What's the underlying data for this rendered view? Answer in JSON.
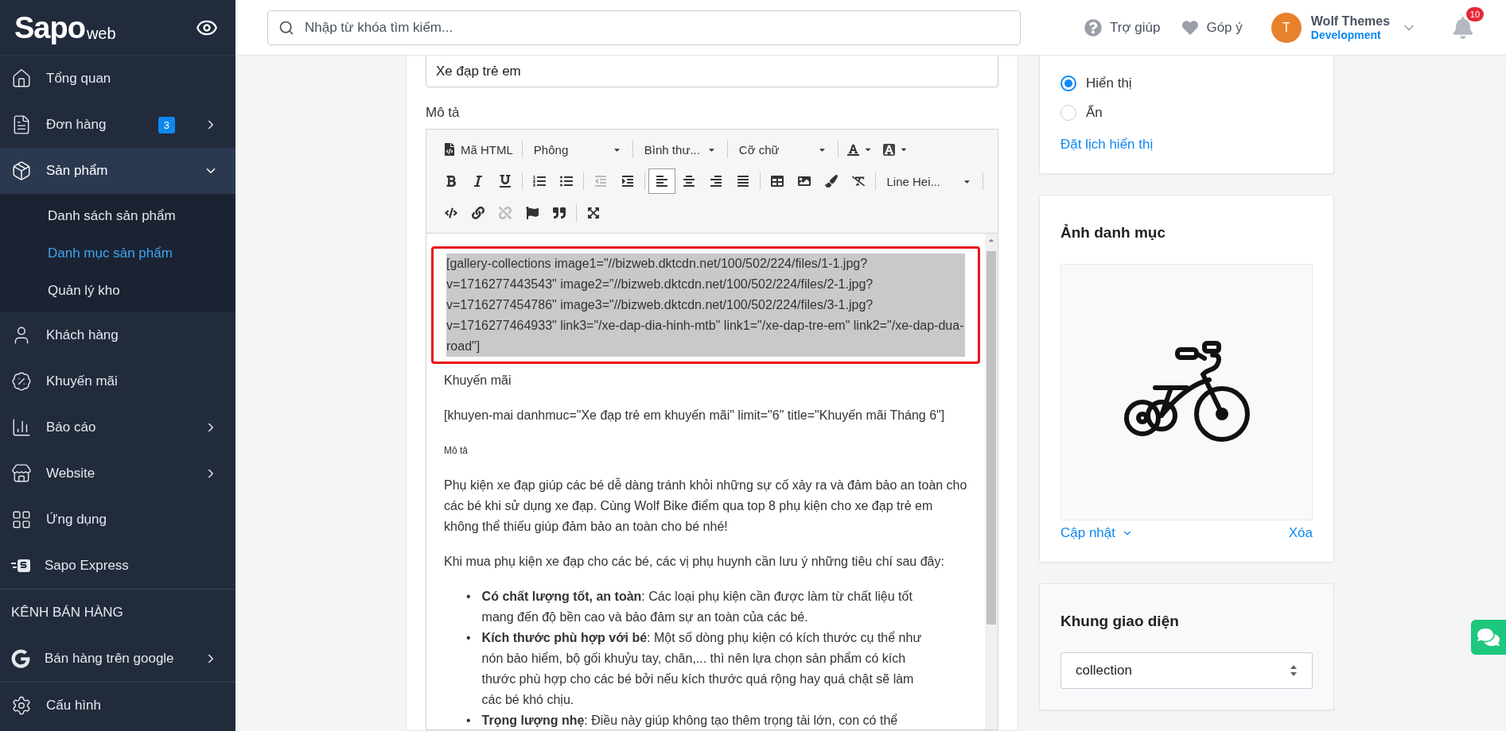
{
  "sidebar": {
    "logo": {
      "brand": "Sapo",
      "suffix": "web"
    },
    "items": [
      {
        "label": "Tổng quan",
        "kind": "home",
        "selected": false
      },
      {
        "label": "Đơn hàng",
        "kind": "orders",
        "selected": false,
        "badge": "3",
        "expanded": false
      },
      {
        "label": "Sản phẩm",
        "kind": "product",
        "selected": true,
        "expanded": true,
        "children": [
          {
            "label": "Danh sách sản phẩm",
            "selected": false
          },
          {
            "label": "Danh mục sản phẩm",
            "selected": true
          },
          {
            "label": "Quản lý kho",
            "selected": false
          }
        ]
      },
      {
        "label": "Khách hàng",
        "kind": "customer",
        "selected": false
      },
      {
        "label": "Khuyến mãi",
        "kind": "promo",
        "selected": false
      },
      {
        "label": "Báo cáo",
        "kind": "report",
        "selected": false,
        "expanded": false
      },
      {
        "label": "Website",
        "kind": "website",
        "selected": false,
        "expanded": false
      },
      {
        "label": "Ứng dụng",
        "kind": "apps",
        "selected": false
      },
      {
        "label": "Sapo Express",
        "kind": "express",
        "selected": false
      }
    ],
    "section_title": "KÊNH BÁN HÀNG",
    "channels": [
      {
        "label": "Bán hàng trên google",
        "kind": "google",
        "selected": false,
        "expanded": false
      }
    ],
    "footer": {
      "label": "Cấu hình",
      "kind": "settings",
      "selected": false
    }
  },
  "header": {
    "search": {
      "placeholder": "Nhập từ khóa tìm kiếm..."
    },
    "help": "Trợ giúp",
    "feedback": "Góp ý",
    "user": {
      "initial": "T",
      "name": "Wolf Themes",
      "store": "Development"
    },
    "notifications": "10"
  },
  "form": {
    "name_value": "Xe đạp trẻ em",
    "description_label": "Mô tả",
    "toolbar": [
      [
        {
          "kind": "html",
          "label": "Mã HTML"
        },
        {
          "kind": "dropdown",
          "label": "Phông"
        },
        {
          "kind": "dropdown",
          "label": "Bình thư..."
        },
        {
          "kind": "dropdown",
          "label": "Cỡ chữ"
        },
        {
          "kind": "fontcolor"
        },
        {
          "kind": "backcolor"
        }
      ],
      [
        {
          "kind": "bold"
        },
        {
          "kind": "italic"
        },
        {
          "kind": "underline"
        },
        {
          "kind": "olist"
        },
        {
          "kind": "ulist"
        },
        {
          "kind": "outdent",
          "disabled": true
        },
        {
          "kind": "indent"
        },
        {
          "kind": "alignleft",
          "selected": true
        },
        {
          "kind": "aligncenter",
          "selected": false
        },
        {
          "kind": "alignright",
          "selected": false
        },
        {
          "kind": "justify",
          "selected": false
        },
        {
          "kind": "table"
        },
        {
          "kind": "image"
        },
        {
          "kind": "brush"
        },
        {
          "kind": "clear"
        },
        {
          "kind": "dropdown",
          "label": "Line Hei..."
        }
      ],
      [
        {
          "kind": "code"
        },
        {
          "kind": "link"
        },
        {
          "kind": "unlink",
          "disabled": true
        },
        {
          "kind": "flag"
        },
        {
          "kind": "quote"
        },
        {
          "kind": "fullscreen"
        }
      ]
    ],
    "content": [
      {
        "kind": "highlight",
        "text": "[gallery-collections image1=\"//bizweb.dktcdn.net/100/502/224/files/1-1.jpg?v=1716277443543\" image2=\"//bizweb.dktcdn.net/100/502/224/files/2-1.jpg?v=1716277454786\" image3=\"//bizweb.dktcdn.net/100/502/224/files/3-1.jpg?v=1716277464933\" link3=\"/xe-dap-dia-hinh-mtb\" link1=\"/xe-dap-tre-em\" link2=\"/xe-dap-dua-road\"]"
      },
      {
        "kind": "paragraph",
        "text": "Khuyến mãi"
      },
      {
        "kind": "paragraph",
        "text": "[khuyen-mai danhmuc=\"Xe đạp trẻ em khuyến mãi\" limit=\"6\" title=\"Khuyến mãi Tháng 6\"]"
      },
      {
        "kind": "small",
        "text": "Mô tả"
      },
      {
        "kind": "paragraph",
        "text": "Phụ kiện xe đạp giúp các bé dễ dàng tránh khỏi những sự cố xảy ra và đảm bảo an toàn cho các bé khi sử dụng xe đạp. Cùng Wolf Bike điểm qua top 8 phụ kiện cho xe đạp trẻ em không thể thiếu giúp đảm bảo an toàn cho bé nhé!"
      },
      {
        "kind": "paragraph",
        "text": "Khi mua phụ kiện xe đạp cho các bé, các vị phụ huynh cần lưu ý những tiêu chí sau đây:"
      },
      {
        "kind": "list",
        "bullet": "•",
        "items": [
          "**Có chất lượng tốt, an toàn**: Các loại phụ kiện cần được làm từ chất liệu tốt mang đến độ bền cao và bảo đảm sự an toàn của các bé.",
          "**Kích thước phù hợp với bé**: Một số dòng phụ kiện có kích thước cụ thể như nón bảo hiểm, bộ gối khuỷu tay, chân,... thì nên lựa chọn sản phẩm có kích thước phù hợp cho các bé bởi nếu kích thước quá rộng hay quá chật sẽ làm các bé khó chịu.",
          "**Trọng lượng nhẹ**: Điều này giúp không tạo thêm trọng tải lớn, con có thể"
        ]
      }
    ]
  },
  "visibility": {
    "options": [
      {
        "label": "Hiển thị",
        "selected": true
      },
      {
        "label": "Ẩn",
        "selected": false
      }
    ],
    "schedule_link": "Đặt lịch hiển thị"
  },
  "image_card": {
    "title": "Ảnh danh mục",
    "update": "Cập nhật",
    "delete": "Xóa"
  },
  "template_card": {
    "title": "Khung giao diện",
    "value": "collection"
  }
}
